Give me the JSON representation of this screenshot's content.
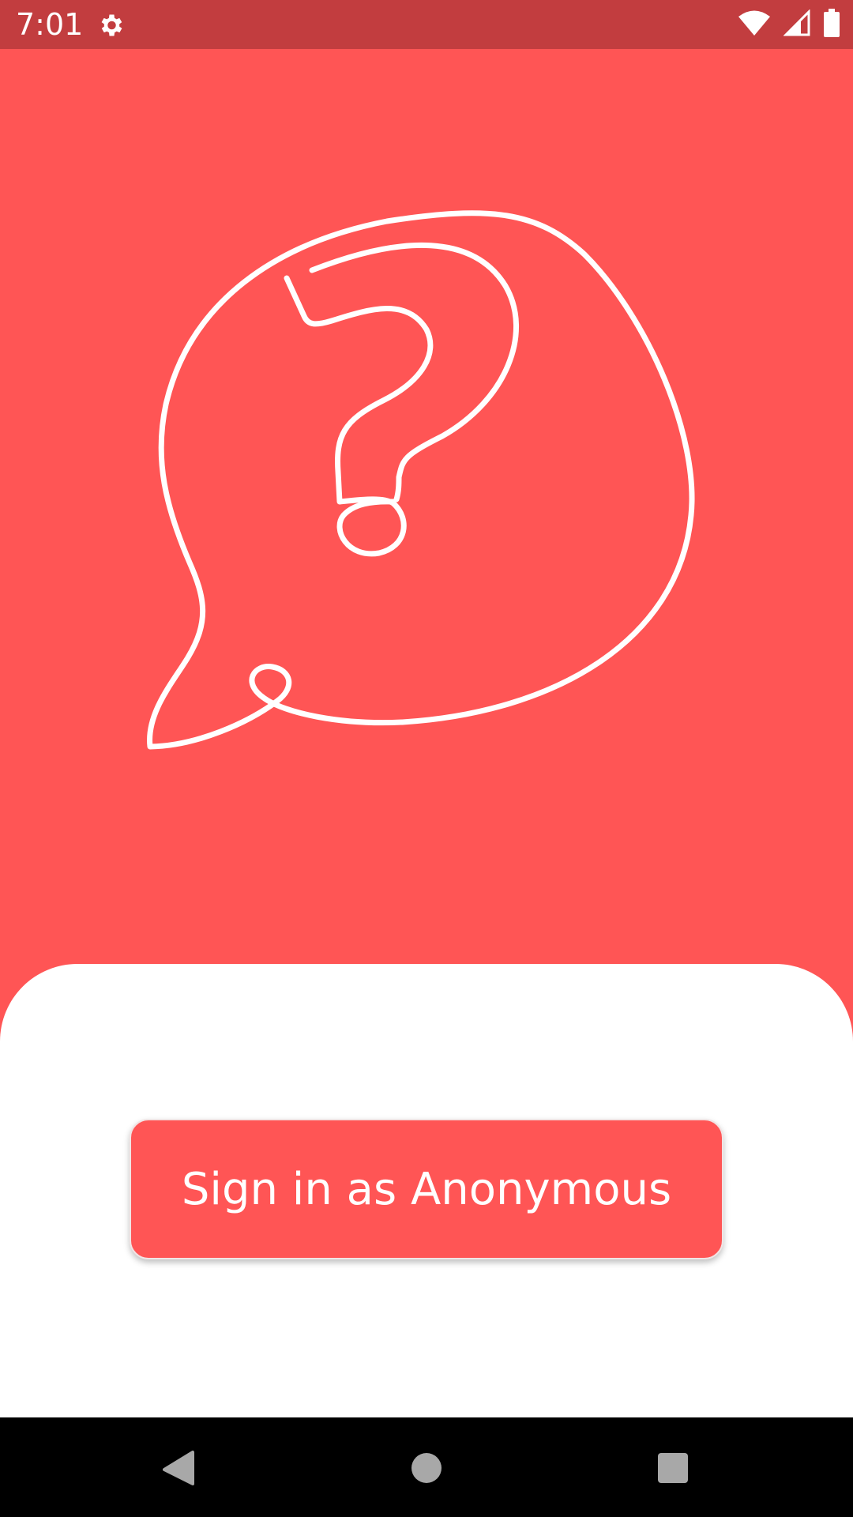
{
  "status_bar": {
    "time": "7:01",
    "background": "#C23D3F",
    "icons": {
      "settings": "gear-icon",
      "wifi": "wifi-icon",
      "signal": "cellular-signal-icon",
      "battery": "battery-icon"
    }
  },
  "hero": {
    "background": "#FF5555",
    "illustration": "speech-bubble-question-icon"
  },
  "sign_in": {
    "button_label": "Sign in as Anonymous",
    "accent_color": "#FF5555"
  },
  "nav_bar": {
    "icons": {
      "back": "back-triangle-icon",
      "home": "home-circle-icon",
      "recents": "recents-square-icon"
    }
  }
}
